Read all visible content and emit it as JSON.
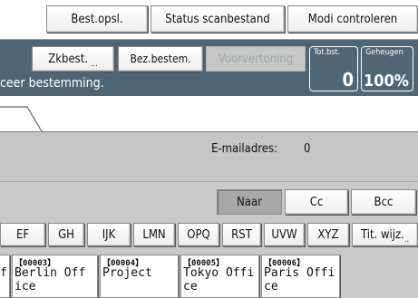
{
  "top_buttons": {
    "best_opsl": "Best.opsl.",
    "status_scan": "Status scanbestand",
    "modi_controleren": "Modi controleren"
  },
  "header": {
    "zkbest": "Zkbest.",
    "bez_bestem": "Bez.bestem.",
    "voorvertoning": "Voorvertoning",
    "instruction": "ceer bestemming.",
    "tot_bst_label": "Tot.bst.",
    "tot_bst_value": "0",
    "geheugen_label": "Geheugen",
    "geheugen_value": "100%"
  },
  "email": {
    "label": "E-mailadres:",
    "count": "0"
  },
  "recipient_type": {
    "naar": "Naar",
    "cc": "Cc",
    "bcc": "Bcc",
    "selected": "Naar"
  },
  "index_tabs": [
    "EF",
    "GH",
    "IJK",
    "LMN",
    "OPQ",
    "RST",
    "UVW",
    "XYZ"
  ],
  "tit_wijz": "Tit. wijz.",
  "destinations": [
    {
      "reg": "",
      "name": "f"
    },
    {
      "reg": "【00003】",
      "name": "Berlin Off\nice"
    },
    {
      "reg": "【00004】",
      "name": "Project"
    },
    {
      "reg": "【00005】",
      "name": "Tokyo Offi\nce"
    },
    {
      "reg": "【00006】",
      "name": "Paris Offi\nce"
    }
  ]
}
